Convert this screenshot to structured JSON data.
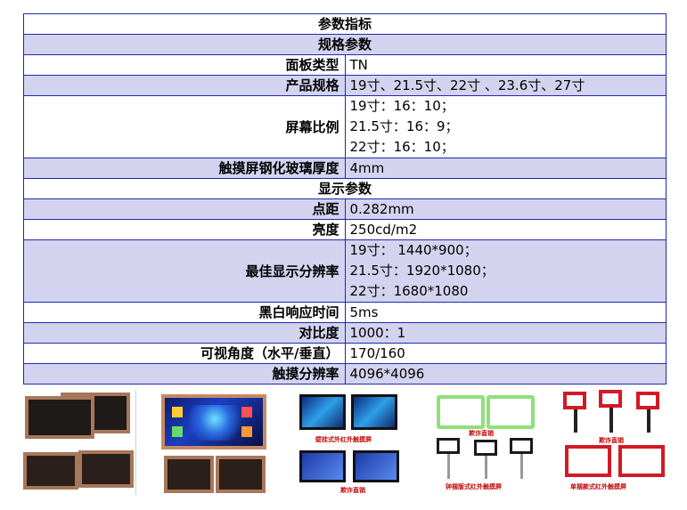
{
  "table": {
    "title": "参数指标",
    "section1": "规格参数",
    "rows1": [
      {
        "key": "面板类型",
        "lines": [
          "TN"
        ]
      },
      {
        "key": "产品规格",
        "lines": [
          "19寸、21.5寸、22寸 、23.6寸、27寸"
        ]
      },
      {
        "key": "屏幕比例",
        "lines": [
          "19寸：16：10；",
          "21.5寸：16：9；",
          "22寸：16：10；"
        ]
      },
      {
        "key": "触摸屏钢化玻璃厚度",
        "lines": [
          "4mm"
        ]
      }
    ],
    "section2": "显示参数",
    "rows2": [
      {
        "key": "点距",
        "lines": [
          "0.282mm"
        ]
      },
      {
        "key": "亮度",
        "lines": [
          "250cd/m2"
        ]
      },
      {
        "key": "最佳显示分辨率",
        "lines": [
          "19寸： 1440*900；",
          "21.5寸：1920*1080；",
          "22寸：1680*1080"
        ]
      },
      {
        "key": "黑白响应时间",
        "lines": [
          "5ms"
        ]
      },
      {
        "key": "对比度",
        "lines": [
          "1000：1"
        ]
      },
      {
        "key": "可视角度（水平/垂直）",
        "lines": [
          "170/160"
        ]
      },
      {
        "key": "触摸分辨率",
        "lines": [
          "4096*4096"
        ]
      }
    ]
  },
  "gallery": {
    "captions": {
      "thumb3_a": "壁挂式外红外触摸屏",
      "thumb3_b": "欺诈直销",
      "thumb4_a": "欺诈直销",
      "thumb4_b": "钟摆版式红外触摸屏",
      "thumb5_a": "欺诈直销",
      "thumb5_b": "单摆款式红外触摸屏"
    },
    "colors": {
      "bronze_frame": "#a8775a",
      "screen_dark": "#1e1a18",
      "green_frame": "#8fe07a",
      "red_frame": "#d21a24"
    }
  }
}
